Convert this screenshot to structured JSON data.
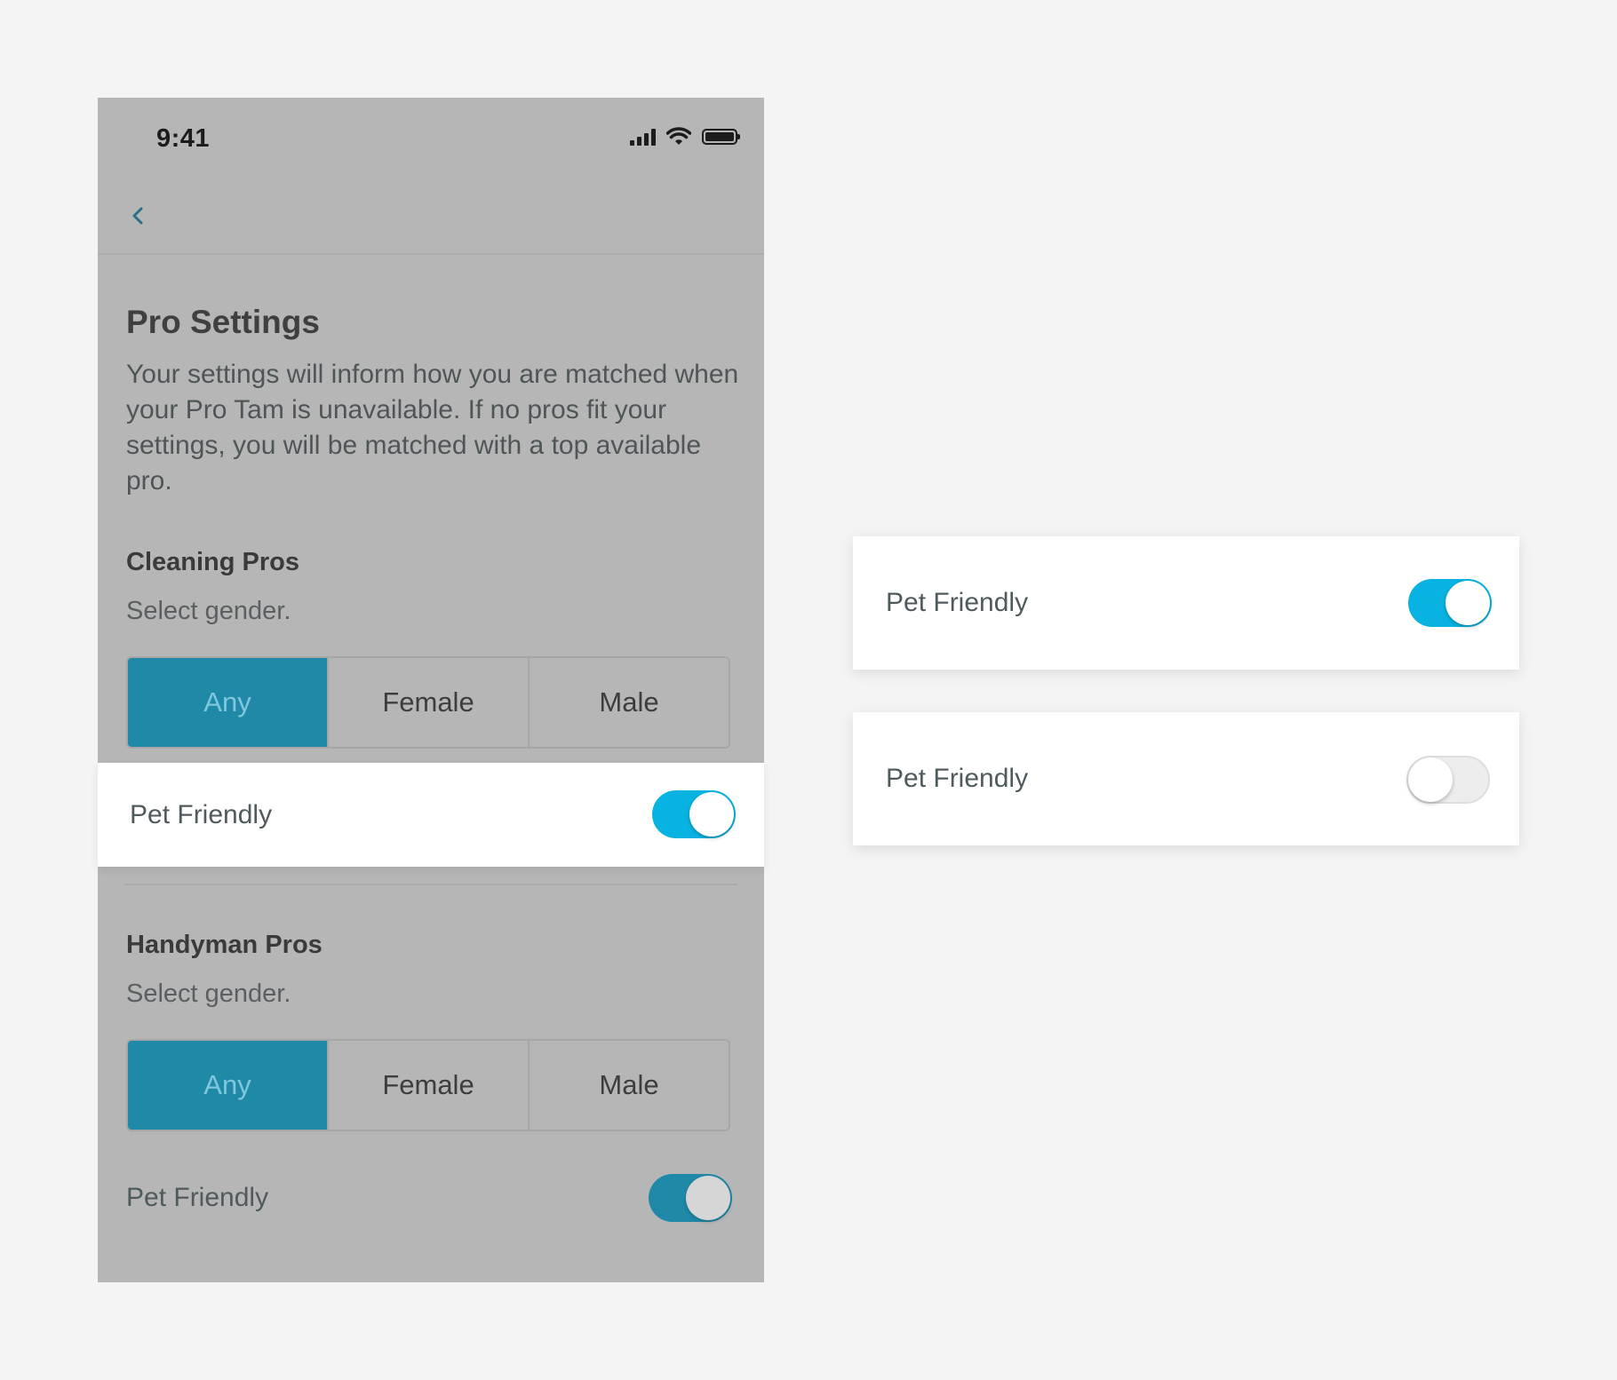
{
  "status_bar": {
    "time": "9:41",
    "icons": [
      "signal-icon",
      "wifi-icon",
      "battery-icon"
    ]
  },
  "nav": {
    "back_icon": "chevron-left-icon"
  },
  "page": {
    "title": "Pro Settings",
    "description": "Your settings will inform how you are matched when your Pro Tam is unavailable. If no pros fit your settings, you will be matched with a top available pro."
  },
  "cleaning": {
    "title": "Cleaning Pros",
    "subtitle": "Select gender.",
    "options": [
      "Any",
      "Female",
      "Male"
    ],
    "selected": "Any",
    "pet_friendly_label": "Pet Friendly",
    "pet_friendly_on": true
  },
  "handyman": {
    "title": "Handyman Pros",
    "subtitle": "Select gender.",
    "options": [
      "Any",
      "Female",
      "Male"
    ],
    "selected": "Any",
    "pet_friendly_label": "Pet Friendly",
    "pet_friendly_on": true
  },
  "cards": [
    {
      "label": "Pet Friendly",
      "toggle_on": true
    },
    {
      "label": "Pet Friendly",
      "toggle_on": false
    }
  ],
  "colors": {
    "accent": "#08b3e1",
    "accent_dimmed": "#2089a8",
    "overlay_gray": "#b6b6b6",
    "page_background": "#f4f4f4"
  }
}
